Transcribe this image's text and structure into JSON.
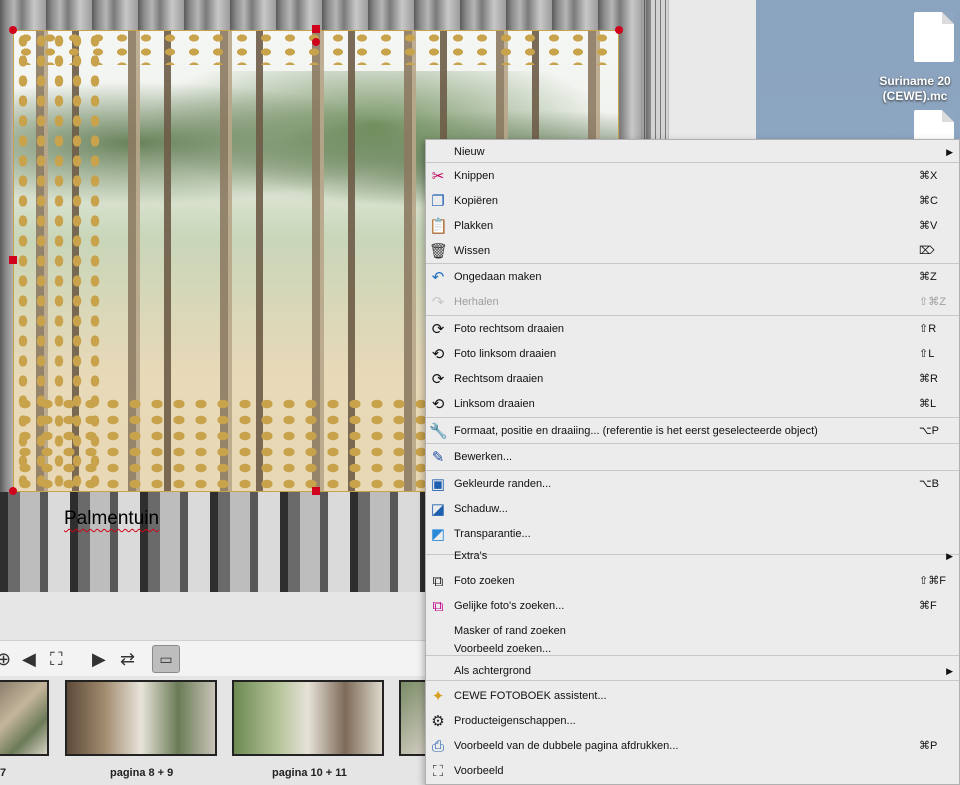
{
  "canvas": {
    "caption": "Palmentuin"
  },
  "desktop": {
    "file_label": "Suriname 20\n(CEWE).mc"
  },
  "filmstrip": {
    "labels": [
      "7",
      "pagina 8 + 9",
      "pagina 10 + 11"
    ]
  },
  "menu": {
    "items": [
      {
        "label": "Nieuw",
        "shortcut": "",
        "icon": "",
        "submenu": true
      },
      {
        "label": "Knippen",
        "shortcut": "⌘X",
        "icon": "scissors-icon"
      },
      {
        "label": "Kopiëren",
        "shortcut": "⌘C",
        "icon": "copy-icon"
      },
      {
        "label": "Plakken",
        "shortcut": "⌘V",
        "icon": "paste-icon"
      },
      {
        "label": "Wissen",
        "shortcut": "⌦",
        "icon": "trash-icon"
      },
      {
        "label": "Ongedaan maken",
        "shortcut": "⌘Z",
        "icon": "undo-icon"
      },
      {
        "label": "Herhalen",
        "shortcut": "⇧⌘Z",
        "icon": "redo-icon",
        "disabled": true
      },
      {
        "label": "Foto rechtsom draaien",
        "shortcut": "⇧R",
        "icon": "rotate-photo-cw-icon"
      },
      {
        "label": "Foto linksom draaien",
        "shortcut": "⇧L",
        "icon": "rotate-photo-ccw-icon"
      },
      {
        "label": "Rechtsom draaien",
        "shortcut": "⌘R",
        "icon": "rotate-cw-icon"
      },
      {
        "label": "Linksom draaien",
        "shortcut": "⌘L",
        "icon": "rotate-ccw-icon"
      },
      {
        "label": "Formaat, positie en draaiing... (referentie is het eerst geselecteerde object)",
        "shortcut": "⌥P",
        "icon": "wrench-icon"
      },
      {
        "label": "Bewerken...",
        "shortcut": "",
        "icon": "edit-icon"
      },
      {
        "label": "Gekleurde randen...",
        "shortcut": "⌥B",
        "icon": "colored-border-icon"
      },
      {
        "label": "Schaduw...",
        "shortcut": "",
        "icon": "shadow-icon"
      },
      {
        "label": "Transparantie...",
        "shortcut": "",
        "icon": "transparency-icon"
      },
      {
        "label": "Extra's",
        "shortcut": "",
        "icon": "",
        "submenu": true
      },
      {
        "label": "Foto zoeken",
        "shortcut": "⇧⌘F",
        "icon": "find-photo-icon"
      },
      {
        "label": "Gelijke foto's zoeken...",
        "shortcut": "⌘F",
        "icon": "find-similar-icon"
      },
      {
        "label": "Masker of rand zoeken",
        "shortcut": "",
        "icon": ""
      },
      {
        "label": "Voorbeeld zoeken...",
        "shortcut": "",
        "icon": ""
      },
      {
        "label": "Als achtergrond",
        "shortcut": "",
        "icon": "",
        "submenu": true
      },
      {
        "label": "CEWE FOTOBOEK assistent...",
        "shortcut": "",
        "icon": "magic-wand-icon"
      },
      {
        "label": "Producteigenschappen...",
        "shortcut": "",
        "icon": "gear-icon"
      },
      {
        "label": "Voorbeeld van de dubbele pagina afdrukken...",
        "shortcut": "⌘P",
        "icon": "print-icon"
      },
      {
        "label": "Voorbeeld",
        "shortcut": "",
        "icon": "preview-icon"
      }
    ]
  },
  "colors": {
    "handle": "#d0021b",
    "leopard_spots": "#c9a24c",
    "menu_bg": "#ececec",
    "desktop_bg": "#8aa3be"
  }
}
